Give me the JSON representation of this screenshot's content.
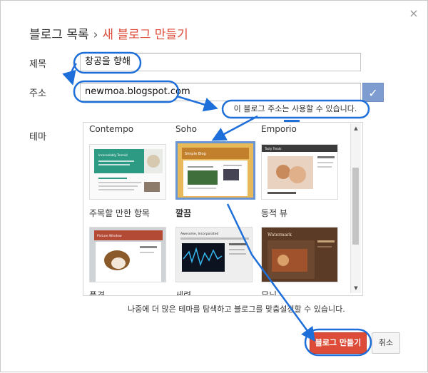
{
  "dialog": {
    "breadcrumb_parent": "블로그 목록",
    "breadcrumb_separator": "›",
    "breadcrumb_current": "새 블로그 만들기",
    "close_label": "×"
  },
  "form": {
    "title_label": "제목",
    "title_value": "창공을 향해",
    "address_label": "주소",
    "address_value": "newmoa.blogspot.com",
    "availability_message": "이 블로그 주소는 사용할 수 있습니다.",
    "theme_label": "테마"
  },
  "themes": {
    "row1_names": [
      "Contempo",
      "Soho",
      "Emporio"
    ],
    "row1_thumb_texts": [
      "Inconsolably Torenid",
      "Simple Blog",
      "Tasty Treats"
    ],
    "row2_labels": [
      "주목할 만한 항목",
      "깔끔",
      "동적 뷰"
    ],
    "row2_thumb_texts": [
      "Picture Window",
      "Awesome, Incorporated",
      "Watermark"
    ],
    "row3_labels": [
      "풍경",
      "세련",
      "무늬"
    ],
    "selected_index": 1
  },
  "helper_text": "나중에 더 많은 테마를 탐색하고 블로그를 맞춤설정할 수 있습니다.",
  "buttons": {
    "create": "블로그 만들기",
    "cancel": "취소"
  },
  "colors": {
    "accent": "#dd4b39",
    "annotation": "#1e6fd9",
    "check_bg": "#7e9ccf"
  }
}
